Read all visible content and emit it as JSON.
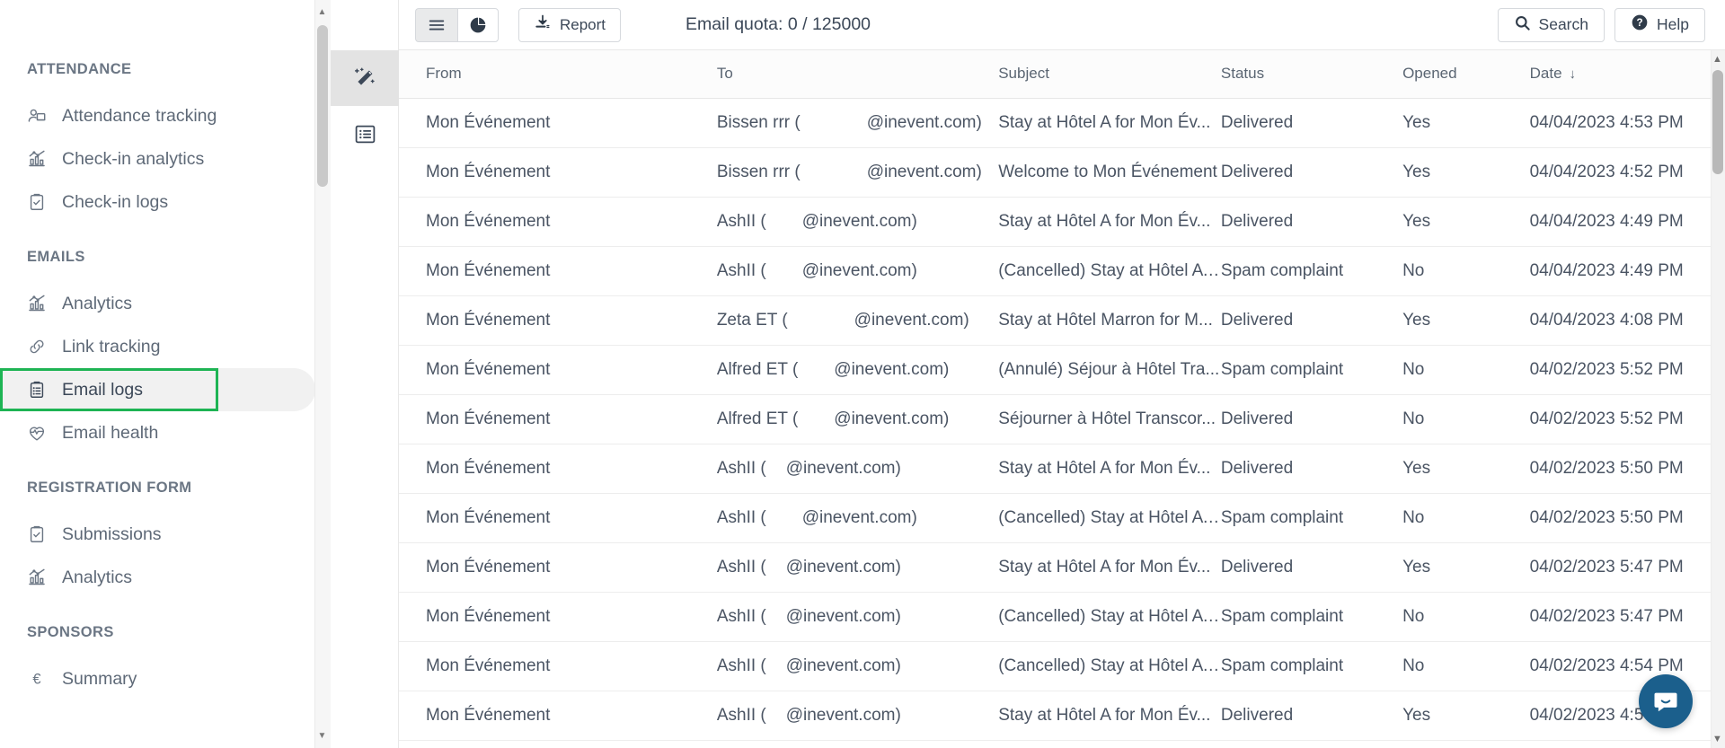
{
  "sidebar": {
    "sections": [
      {
        "title": "ATTENDANCE",
        "items": [
          {
            "label": "Attendance tracking",
            "icon": "attendance-tracking-icon"
          },
          {
            "label": "Check-in analytics",
            "icon": "bar-chart-icon"
          },
          {
            "label": "Check-in logs",
            "icon": "clipboard-check-icon"
          }
        ]
      },
      {
        "title": "EMAILS",
        "items": [
          {
            "label": "Analytics",
            "icon": "bar-chart-icon"
          },
          {
            "label": "Link tracking",
            "icon": "link-icon"
          },
          {
            "label": "Email logs",
            "icon": "clipboard-list-icon",
            "active": true,
            "highlighted": true
          },
          {
            "label": "Email health",
            "icon": "heart-pulse-icon"
          }
        ]
      },
      {
        "title": "REGISTRATION FORM",
        "items": [
          {
            "label": "Submissions",
            "icon": "clipboard-check-icon"
          },
          {
            "label": "Analytics",
            "icon": "bar-chart-icon"
          }
        ]
      },
      {
        "title": "SPONSORS",
        "items": [
          {
            "label": "Summary",
            "icon": "euro-icon"
          }
        ]
      }
    ]
  },
  "icon_rail": {
    "items": [
      {
        "name": "magic-wand-icon",
        "active": true
      },
      {
        "name": "list-view-icon",
        "active": false
      }
    ]
  },
  "toolbar": {
    "list_view_icon": "hamburger-menu-icon",
    "chart_view_icon": "pie-chart-icon",
    "report_label": "Report",
    "report_icon": "download-icon",
    "quota_text": "Email quota: 0 / 125000",
    "search_label": "Search",
    "search_icon": "search-icon",
    "help_label": "Help",
    "help_icon": "question-circle-icon"
  },
  "table": {
    "headers": {
      "from": "From",
      "to": "To",
      "subject": "Subject",
      "status": "Status",
      "opened": "Opened",
      "date": "Date",
      "sort_arrow": "↓"
    },
    "rows": [
      {
        "from": "Mon Événement",
        "to_name": "Bissen rrr (",
        "to_domain": "@inevent.com)",
        "redact": "w1",
        "subject": "Stay at Hôtel A for Mon Év...",
        "status": "Delivered",
        "opened": "Yes",
        "date": "04/04/2023 4:53 PM"
      },
      {
        "from": "Mon Événement",
        "to_name": "Bissen rrr (",
        "to_domain": "@inevent.com)",
        "redact": "w1",
        "subject": "Welcome to Mon Événement",
        "status": "Delivered",
        "opened": "Yes",
        "date": "04/04/2023 4:52 PM"
      },
      {
        "from": "Mon Événement",
        "to_name": "AshII (",
        "to_domain": "@inevent.com)",
        "redact": "w2",
        "subject": "Stay at Hôtel A for Mon Év...",
        "status": "Delivered",
        "opened": "Yes",
        "date": "04/04/2023 4:49 PM"
      },
      {
        "from": "Mon Événement",
        "to_name": "AshII (",
        "to_domain": "@inevent.com)",
        "redact": "w2",
        "subject": "(Cancelled) Stay at Hôtel A ...",
        "status": "Spam complaint",
        "opened": "No",
        "date": "04/04/2023 4:49 PM"
      },
      {
        "from": "Mon Événement",
        "to_name": "Zeta ET (",
        "to_domain": "@inevent.com)",
        "redact": "w1",
        "subject": "Stay at Hôtel Marron for M...",
        "status": "Delivered",
        "opened": "Yes",
        "date": "04/04/2023 4:08 PM"
      },
      {
        "from": "Mon Événement",
        "to_name": "Alfred ET (",
        "to_domain": "@inevent.com)",
        "redact": "w2",
        "subject": "(Annulé) Séjour à Hôtel Tra...",
        "status": "Spam complaint",
        "opened": "No",
        "date": "04/02/2023 5:52 PM"
      },
      {
        "from": "Mon Événement",
        "to_name": "Alfred ET (",
        "to_domain": "@inevent.com)",
        "redact": "w2",
        "subject": "Séjourner à Hôtel Transcor...",
        "status": "Delivered",
        "opened": "No",
        "date": "04/02/2023 5:52 PM"
      },
      {
        "from": "Mon Événement",
        "to_name": "AshII (",
        "to_domain": "@inevent.com)",
        "redact": "w3",
        "subject": "Stay at Hôtel A for Mon Év...",
        "status": "Delivered",
        "opened": "Yes",
        "date": "04/02/2023 5:50 PM"
      },
      {
        "from": "Mon Événement",
        "to_name": "AshII (",
        "to_domain": "@inevent.com)",
        "redact": "w2",
        "subject": "(Cancelled) Stay at Hôtel A ...",
        "status": "Spam complaint",
        "opened": "No",
        "date": "04/02/2023 5:50 PM"
      },
      {
        "from": "Mon Événement",
        "to_name": "AshII (",
        "to_domain": "@inevent.com)",
        "redact": "w3",
        "subject": "Stay at Hôtel A for Mon Év...",
        "status": "Delivered",
        "opened": "Yes",
        "date": "04/02/2023 5:47 PM"
      },
      {
        "from": "Mon Événement",
        "to_name": "AshII (",
        "to_domain": "@inevent.com)",
        "redact": "w3",
        "subject": "(Cancelled) Stay at Hôtel A ...",
        "status": "Spam complaint",
        "opened": "No",
        "date": "04/02/2023 5:47 PM"
      },
      {
        "from": "Mon Événement",
        "to_name": "AshII (",
        "to_domain": "@inevent.com)",
        "redact": "w3",
        "subject": "(Cancelled) Stay at Hôtel A ...",
        "status": "Spam complaint",
        "opened": "No",
        "date": "04/02/2023 4:54 PM"
      },
      {
        "from": "Mon Événement",
        "to_name": "AshII (",
        "to_domain": "@inevent.com)",
        "redact": "w3",
        "subject": "Stay at Hôtel A for Mon Év...",
        "status": "Delivered",
        "opened": "Yes",
        "date": "04/02/2023 4:5"
      }
    ]
  },
  "chat": {
    "icon": "intercom-chat-icon",
    "color": "#1b5f8c"
  },
  "colors": {
    "highlight": "#1eb454",
    "active_bg": "#f1f1f1",
    "text": "#3c4858"
  }
}
